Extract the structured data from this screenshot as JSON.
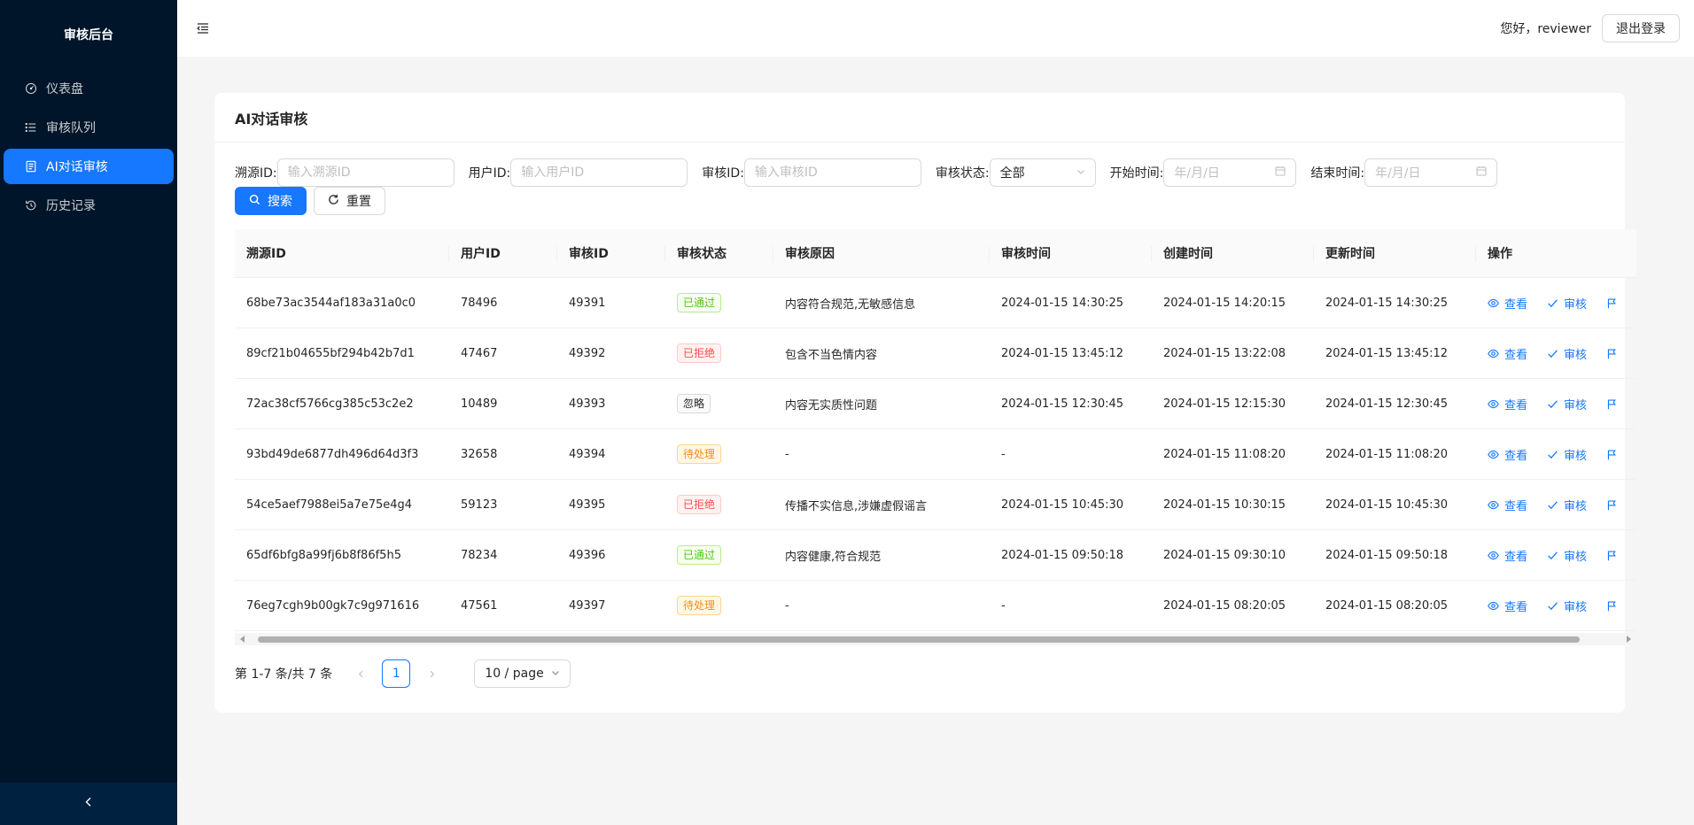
{
  "sidebar": {
    "title": "审核后台",
    "items": [
      {
        "label": "仪表盘",
        "icon": "dashboard-icon"
      },
      {
        "label": "审核队列",
        "icon": "list-icon"
      },
      {
        "label": "AI对话审核",
        "icon": "document-icon",
        "active": true
      },
      {
        "label": "历史记录",
        "icon": "history-icon"
      }
    ],
    "collapse_icon": "chevron-left-icon"
  },
  "header": {
    "menu_toggle_icon": "menu-fold-icon",
    "greeting": "您好，reviewer",
    "logout_label": "退出登录"
  },
  "card": {
    "title": "AI对话审核"
  },
  "filters": {
    "source_id": {
      "label": "溯源ID:",
      "placeholder": "输入溯源ID"
    },
    "user_id": {
      "label": "用户ID:",
      "placeholder": "输入用户ID"
    },
    "review_id": {
      "label": "审核ID:",
      "placeholder": "输入审核ID"
    },
    "status": {
      "label": "审核状态:",
      "value": "全部"
    },
    "start_time": {
      "label": "开始时间:",
      "placeholder": "年/月/日"
    },
    "end_time": {
      "label": "结束时间:",
      "placeholder": "年/月/日"
    },
    "search_label": "搜索",
    "reset_label": "重置"
  },
  "table": {
    "columns": [
      "溯源ID",
      "用户ID",
      "审核ID",
      "审核状态",
      "审核原因",
      "审核时间",
      "创建时间",
      "更新时间",
      "操作"
    ],
    "actions": {
      "view": "查看",
      "review": "审核"
    },
    "rows": [
      {
        "source_id": "68be73ac3544af183a31a0c0",
        "user_id": "78496",
        "review_id": "49391",
        "status": "已通过",
        "status_type": "approved",
        "reason": "内容符合规范,无敏感信息",
        "review_time": "2024-01-15 14:30:25",
        "create_time": "2024-01-15 14:20:15",
        "update_time": "2024-01-15 14:30:25"
      },
      {
        "source_id": "89cf21b04655bf294b42b7d1",
        "user_id": "47467",
        "review_id": "49392",
        "status": "已拒绝",
        "status_type": "rejected",
        "reason": "包含不当色情内容",
        "review_time": "2024-01-15 13:45:12",
        "create_time": "2024-01-15 13:22:08",
        "update_time": "2024-01-15 13:45:12"
      },
      {
        "source_id": "72ac38cf5766cg385c53c2e2",
        "user_id": "10489",
        "review_id": "49393",
        "status": "忽略",
        "status_type": "ignored",
        "reason": "内容无实质性问题",
        "review_time": "2024-01-15 12:30:45",
        "create_time": "2024-01-15 12:15:30",
        "update_time": "2024-01-15 12:30:45"
      },
      {
        "source_id": "93bd49de6877dh496d64d3f3",
        "user_id": "32658",
        "review_id": "49394",
        "status": "待处理",
        "status_type": "pending",
        "reason": "-",
        "review_time": "-",
        "create_time": "2024-01-15 11:08:20",
        "update_time": "2024-01-15 11:08:20"
      },
      {
        "source_id": "54ce5aef7988ei5a7e75e4g4",
        "user_id": "59123",
        "review_id": "49395",
        "status": "已拒绝",
        "status_type": "rejected",
        "reason": "传播不实信息,涉嫌虚假谣言",
        "review_time": "2024-01-15 10:45:30",
        "create_time": "2024-01-15 10:30:15",
        "update_time": "2024-01-15 10:45:30"
      },
      {
        "source_id": "65df6bfg8a99fj6b8f86f5h5",
        "user_id": "78234",
        "review_id": "49396",
        "status": "已通过",
        "status_type": "approved",
        "reason": "内容健康,符合规范",
        "review_time": "2024-01-15 09:50:18",
        "create_time": "2024-01-15 09:30:10",
        "update_time": "2024-01-15 09:50:18"
      },
      {
        "source_id": "76eg7cgh9b00gk7c9g971616",
        "user_id": "47561",
        "review_id": "49397",
        "status": "待处理",
        "status_type": "pending",
        "reason": "-",
        "review_time": "-",
        "create_time": "2024-01-15 08:20:05",
        "update_time": "2024-01-15 08:20:05"
      }
    ]
  },
  "pagination": {
    "total_text": "第 1-7 条/共 7 条",
    "current_page": "1",
    "page_size": "10 / page"
  },
  "colors": {
    "primary": "#1677ff",
    "sidebar_bg": "#001529",
    "approved": "#52c41a",
    "rejected": "#ff4d4f",
    "pending": "#fa8c16"
  }
}
